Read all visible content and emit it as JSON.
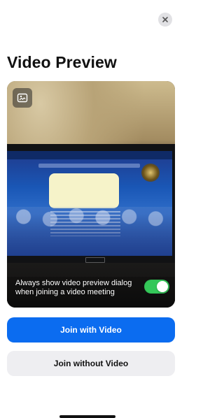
{
  "header": {
    "title": "Video Preview",
    "close_icon": "close-icon"
  },
  "preview": {
    "camera_switch_icon": "camera-switch-icon",
    "option_label": "Always show video preview dialog when joining a video meeting",
    "option_enabled": true,
    "toggle_color": "#34c759"
  },
  "actions": {
    "join_with_video": "Join with Video",
    "join_without_video": "Join without Video",
    "primary_color": "#0b6cf0"
  }
}
